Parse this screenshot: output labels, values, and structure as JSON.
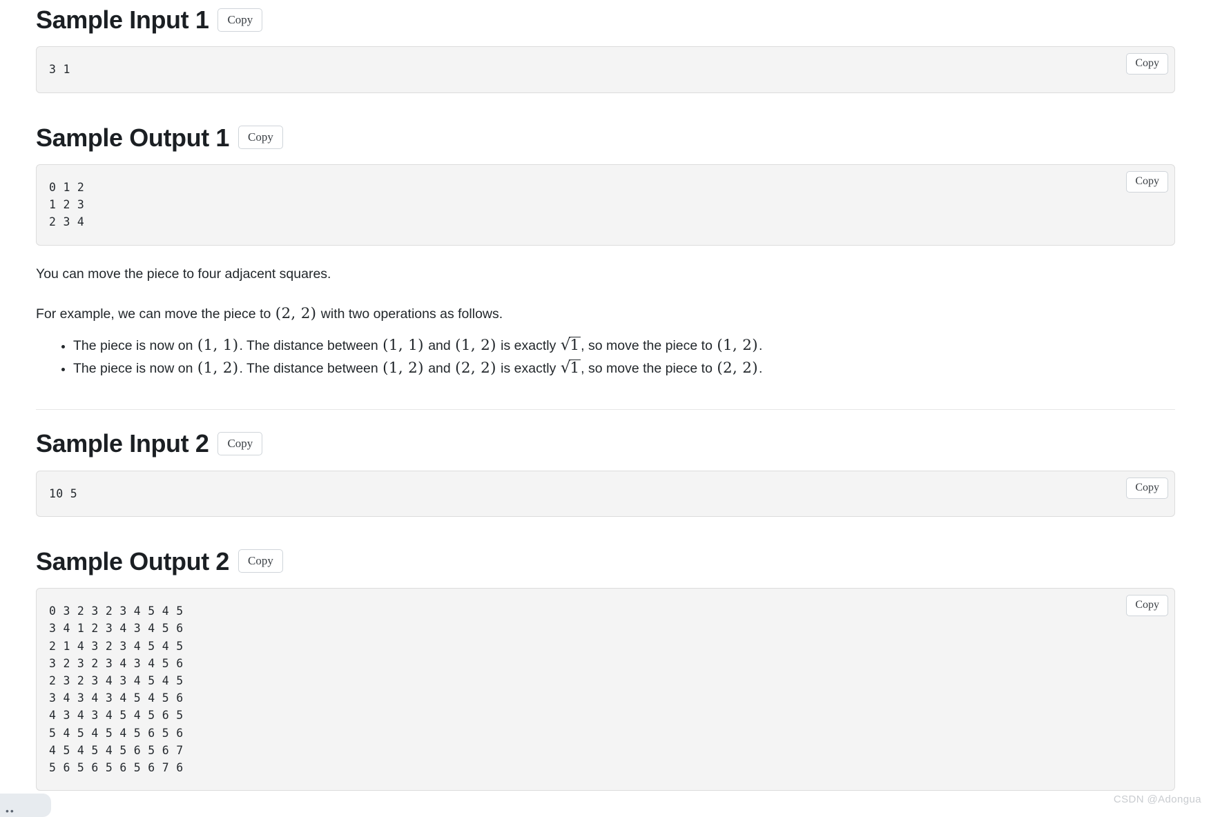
{
  "sections": [
    {
      "key": "sample_input_1",
      "title": "Sample Input 1",
      "heading_copy_label": "Copy",
      "code_copy_label": "Copy",
      "code": "3 1"
    },
    {
      "key": "sample_output_1",
      "title": "Sample Output 1",
      "heading_copy_label": "Copy",
      "code_copy_label": "Copy",
      "code": "0 1 2\n1 2 3\n2 3 4"
    },
    {
      "key": "sample_input_2",
      "title": "Sample Input 2",
      "heading_copy_label": "Copy",
      "code_copy_label": "Copy",
      "code": "10 5"
    },
    {
      "key": "sample_output_2",
      "title": "Sample Output 2",
      "heading_copy_label": "Copy",
      "code_copy_label": "Copy",
      "code": "0 3 2 3 2 3 4 5 4 5\n3 4 1 2 3 4 3 4 5 6\n2 1 4 3 2 3 4 5 4 5\n3 2 3 2 3 4 3 4 5 6\n2 3 2 3 4 3 4 5 4 5\n3 4 3 4 3 4 5 4 5 6\n4 3 4 3 4 5 4 5 6 5\n5 4 5 4 5 4 5 6 5 6\n4 5 4 5 4 5 6 5 6 7\n5 6 5 6 5 6 5 6 7 6"
    }
  ],
  "explanation": {
    "paragraph_1": "You can move the piece to four adjacent squares.",
    "paragraph_2_prefix": "For example, we can move the piece to ",
    "paragraph_2_math": "(2, 2)",
    "paragraph_2_suffix": " with two operations as follows.",
    "bullets": [
      {
        "t1": "The piece is now on ",
        "m1": "(1, 1)",
        "t2": ". The distance between ",
        "m2": "(1, 1)",
        "t3": " and ",
        "m3": "(1, 2)",
        "t4": " is exactly ",
        "radicand": "1",
        "t5": ", so move the piece to ",
        "m4": "(1, 2)",
        "t6": "."
      },
      {
        "t1": "The piece is now on ",
        "m1": "(1, 2)",
        "t2": ". The distance between ",
        "m2": "(1, 2)",
        "t3": " and ",
        "m3": "(2, 2)",
        "t4": " is exactly ",
        "radicand": "1",
        "t5": ", so move the piece to ",
        "m4": "(2, 2)",
        "t6": "."
      }
    ]
  },
  "watermark": {
    "text": "CSDN @Adongua"
  },
  "colors": {
    "page_background": "#ffffff",
    "code_background": "#f4f4f4",
    "code_border": "#dcdcdc",
    "text": "#22272b",
    "heading": "#1b1f23",
    "button_border": "#cfd4d9",
    "divider": "#e6e6e6",
    "watermark": "#c9ccd0"
  }
}
